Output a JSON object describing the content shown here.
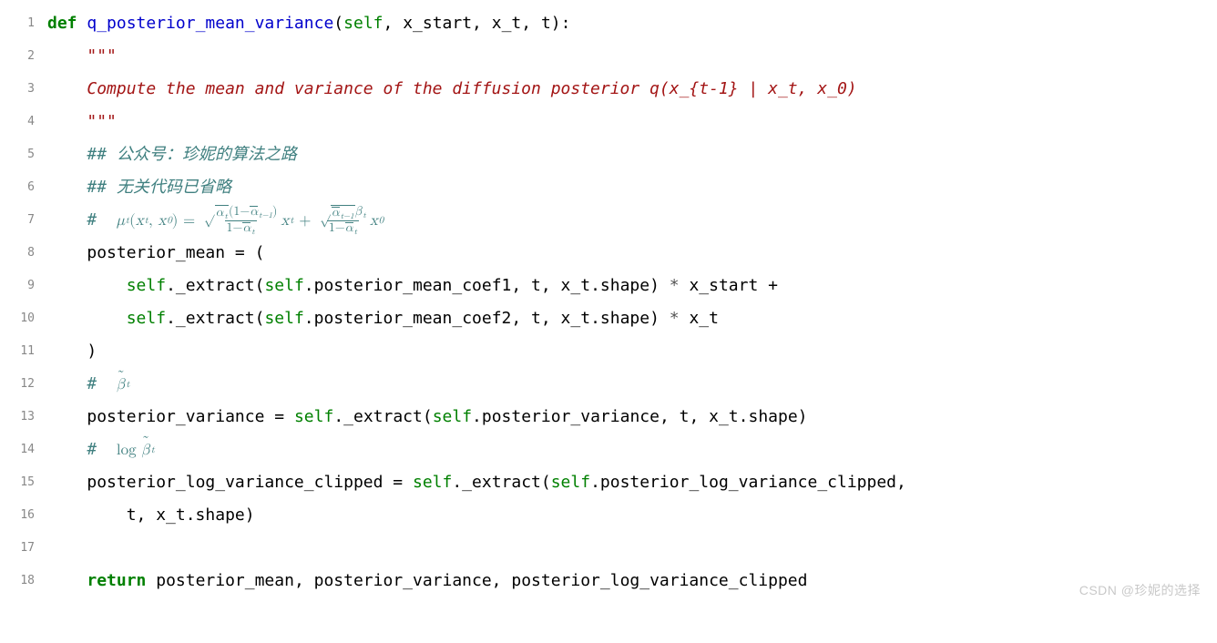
{
  "lines": [
    {
      "n": "1"
    },
    {
      "n": "2"
    },
    {
      "n": "3"
    },
    {
      "n": "4"
    },
    {
      "n": "5"
    },
    {
      "n": "6"
    },
    {
      "n": "7"
    },
    {
      "n": "8"
    },
    {
      "n": "9"
    },
    {
      "n": "10"
    },
    {
      "n": "11"
    },
    {
      "n": "12"
    },
    {
      "n": "13"
    },
    {
      "n": "14"
    },
    {
      "n": "15"
    },
    {
      "n": "16"
    },
    {
      "n": "17"
    },
    {
      "n": "18"
    }
  ],
  "tok": {
    "def": "def",
    "fname": "q_posterior_mean_variance",
    "self": "self",
    "x_start": "x_start",
    "x_t": "x_t",
    "t": "t",
    "triplequote": "\"\"\"",
    "docline": "Compute the mean and variance of the diffusion posterior q(x_{t-1} | x_t, x_0)",
    "comment1": "## 公众号：珍妮的算法之路",
    "comment2": "## 无关代码已省略",
    "hash": "#",
    "posterior_mean": "posterior_mean",
    "eq_open": " = (",
    "extract": "._extract(",
    "coef1": ".posterior_mean_coef1, t, x_t.shape) ",
    "coef2": ".posterior_mean_coef2, t, x_t.shape) ",
    "star": "*",
    "plus": " +",
    "close_paren": ")",
    "posterior_variance": "posterior_variance",
    "eq": " = ",
    "pv_args": ".posterior_variance, t, x_t.shape)",
    "plvc": "posterior_log_variance_clipped",
    "plvc_args": ".posterior_log_variance_clipped,",
    "line16": "t, x_t.shape)",
    "return": "return",
    "retvals": " posterior_mean, posterior_variance, posterior_log_variance_clipped",
    "log": "log"
  },
  "watermark": "CSDN @珍妮的选择"
}
